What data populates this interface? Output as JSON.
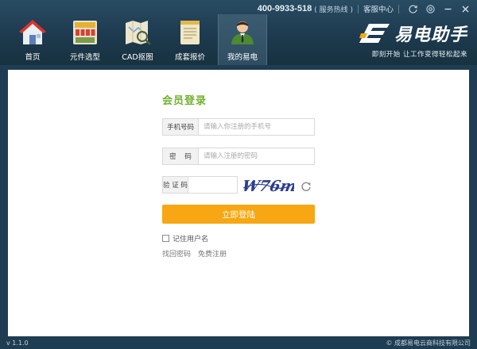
{
  "topbar": {
    "hotline_number": "400-9933-518",
    "hotline_label": "( 服务热线 )",
    "support_label": "客服中心"
  },
  "nav": {
    "items": [
      {
        "label": "首页",
        "icon": "home-icon"
      },
      {
        "label": "元件选型",
        "icon": "component-cabinet-icon"
      },
      {
        "label": "CAD抠图",
        "icon": "cad-map-icon"
      },
      {
        "label": "成套报价",
        "icon": "quote-document-icon"
      },
      {
        "label": "我的易电",
        "icon": "user-profile-icon",
        "active": true
      }
    ]
  },
  "brand": {
    "name": "易电助手",
    "slogan": "即刻开始  让工作变得轻松起来"
  },
  "login": {
    "title": "会员登录",
    "phone_label": "手机号码",
    "phone_placeholder": "请输入你注册的手机号",
    "password_label": "密    码",
    "password_placeholder": "请输入注册的密码",
    "captcha_label": "验 证 码",
    "captcha_text": "W76m",
    "submit_label": "立即登陆",
    "remember_label": "记住用户名",
    "forgot_label": "找回密码",
    "register_label": "免费注册"
  },
  "footer": {
    "version": "v 1.1.0",
    "copyright": "© 成都易电云商科技有限公司"
  },
  "colors": {
    "header_bg": "#1d3a4f",
    "accent_green": "#72b02d",
    "button_orange": "#f7a713"
  }
}
